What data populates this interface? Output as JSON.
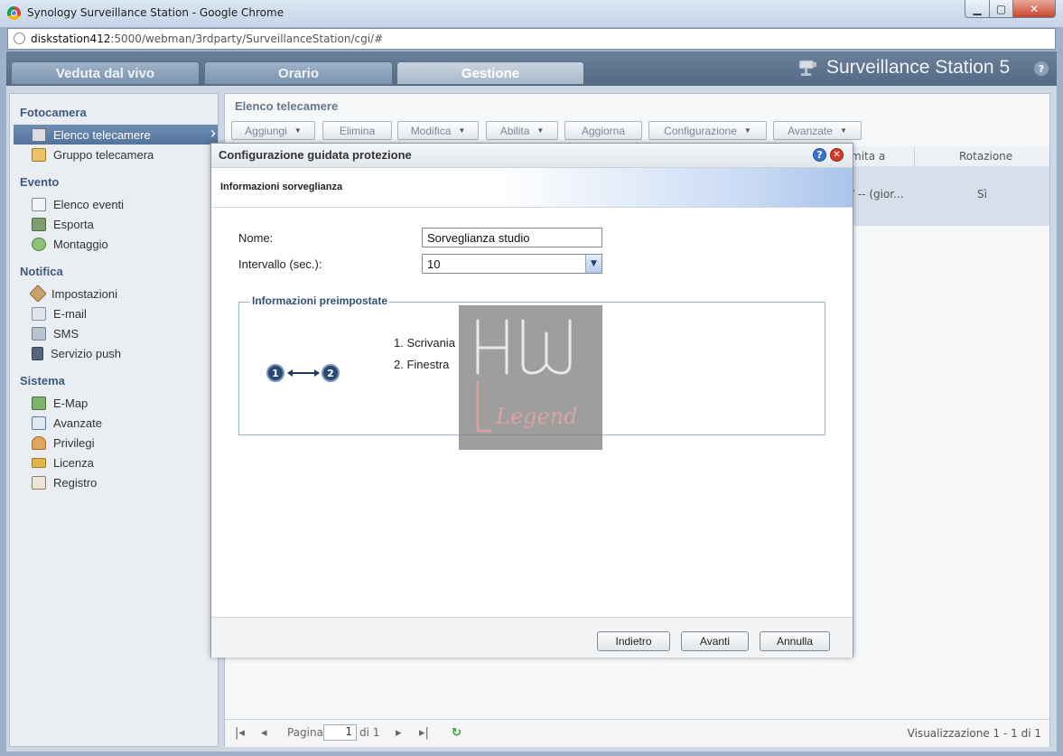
{
  "window": {
    "title": "Synology Surveillance Station - Google Chrome"
  },
  "address": {
    "host": "diskstation412",
    "path": ":5000/webman/3rdparty/SurveillanceStation/cgi/#"
  },
  "app": {
    "brand": "Surveillance Station 5",
    "tabs": [
      "Veduta dal vivo",
      "Orario",
      "Gestione"
    ],
    "active_tab": "Gestione"
  },
  "sidebar": {
    "sections": [
      {
        "title": "Fotocamera",
        "items": [
          {
            "label": "Elenco telecamere",
            "icon": "camera-icon",
            "selected": true
          },
          {
            "label": "Gruppo telecamera",
            "icon": "camera-group-icon"
          }
        ]
      },
      {
        "title": "Evento",
        "items": [
          {
            "label": "Elenco eventi",
            "icon": "event-list-icon"
          },
          {
            "label": "Esporta",
            "icon": "export-icon"
          },
          {
            "label": "Montaggio",
            "icon": "montage-icon"
          }
        ]
      },
      {
        "title": "Notifica",
        "items": [
          {
            "label": "Impostazioni",
            "icon": "wrench-icon"
          },
          {
            "label": "E-mail",
            "icon": "envelope-icon"
          },
          {
            "label": "SMS",
            "icon": "sms-icon"
          },
          {
            "label": "Servizio push",
            "icon": "push-device-icon"
          }
        ]
      },
      {
        "title": "Sistema",
        "items": [
          {
            "label": "E-Map",
            "icon": "map-icon"
          },
          {
            "label": "Avanzate",
            "icon": "advanced-icon"
          },
          {
            "label": "Privilegi",
            "icon": "users-icon"
          },
          {
            "label": "Licenza",
            "icon": "key-icon"
          },
          {
            "label": "Registro",
            "icon": "log-book-icon"
          }
        ]
      }
    ]
  },
  "main": {
    "title": "Elenco telecamere",
    "toolbar": {
      "aggiungi": "Aggiungi",
      "elimina": "Elimina",
      "modifica": "Modifica",
      "abilita": "Abilita",
      "aggiorna": "Aggiorna",
      "configurazione": "Configurazione",
      "avanzate": "Avanzate"
    },
    "grid": {
      "col_partial": "mita a",
      "col_rotation": "Rotazione",
      "row_partial": "/ -- (gior...",
      "row_rotation": "Sì"
    },
    "pager": {
      "page_label": "Pagina",
      "page": "1",
      "of_label": "di 1",
      "summary": "Visualizzazione 1 - 1 di 1"
    }
  },
  "dialog": {
    "title": "Configurazione guidata protezione",
    "subtitle": "Informazioni sorveglianza",
    "name_label": "Nome:",
    "name_value": "Sorveglianza studio",
    "interval_label": "Intervallo (sec.):",
    "interval_value": "10",
    "preset_title": "Informazioni preimpostate",
    "preset_from": "1",
    "preset_to": "2",
    "presets": [
      "1. Scrivania",
      "2. Finestra"
    ],
    "buttons": {
      "back": "Indietro",
      "next": "Avanti",
      "cancel": "Annulla"
    }
  },
  "watermark": {
    "line1": "HW",
    "line2": "Legend"
  }
}
